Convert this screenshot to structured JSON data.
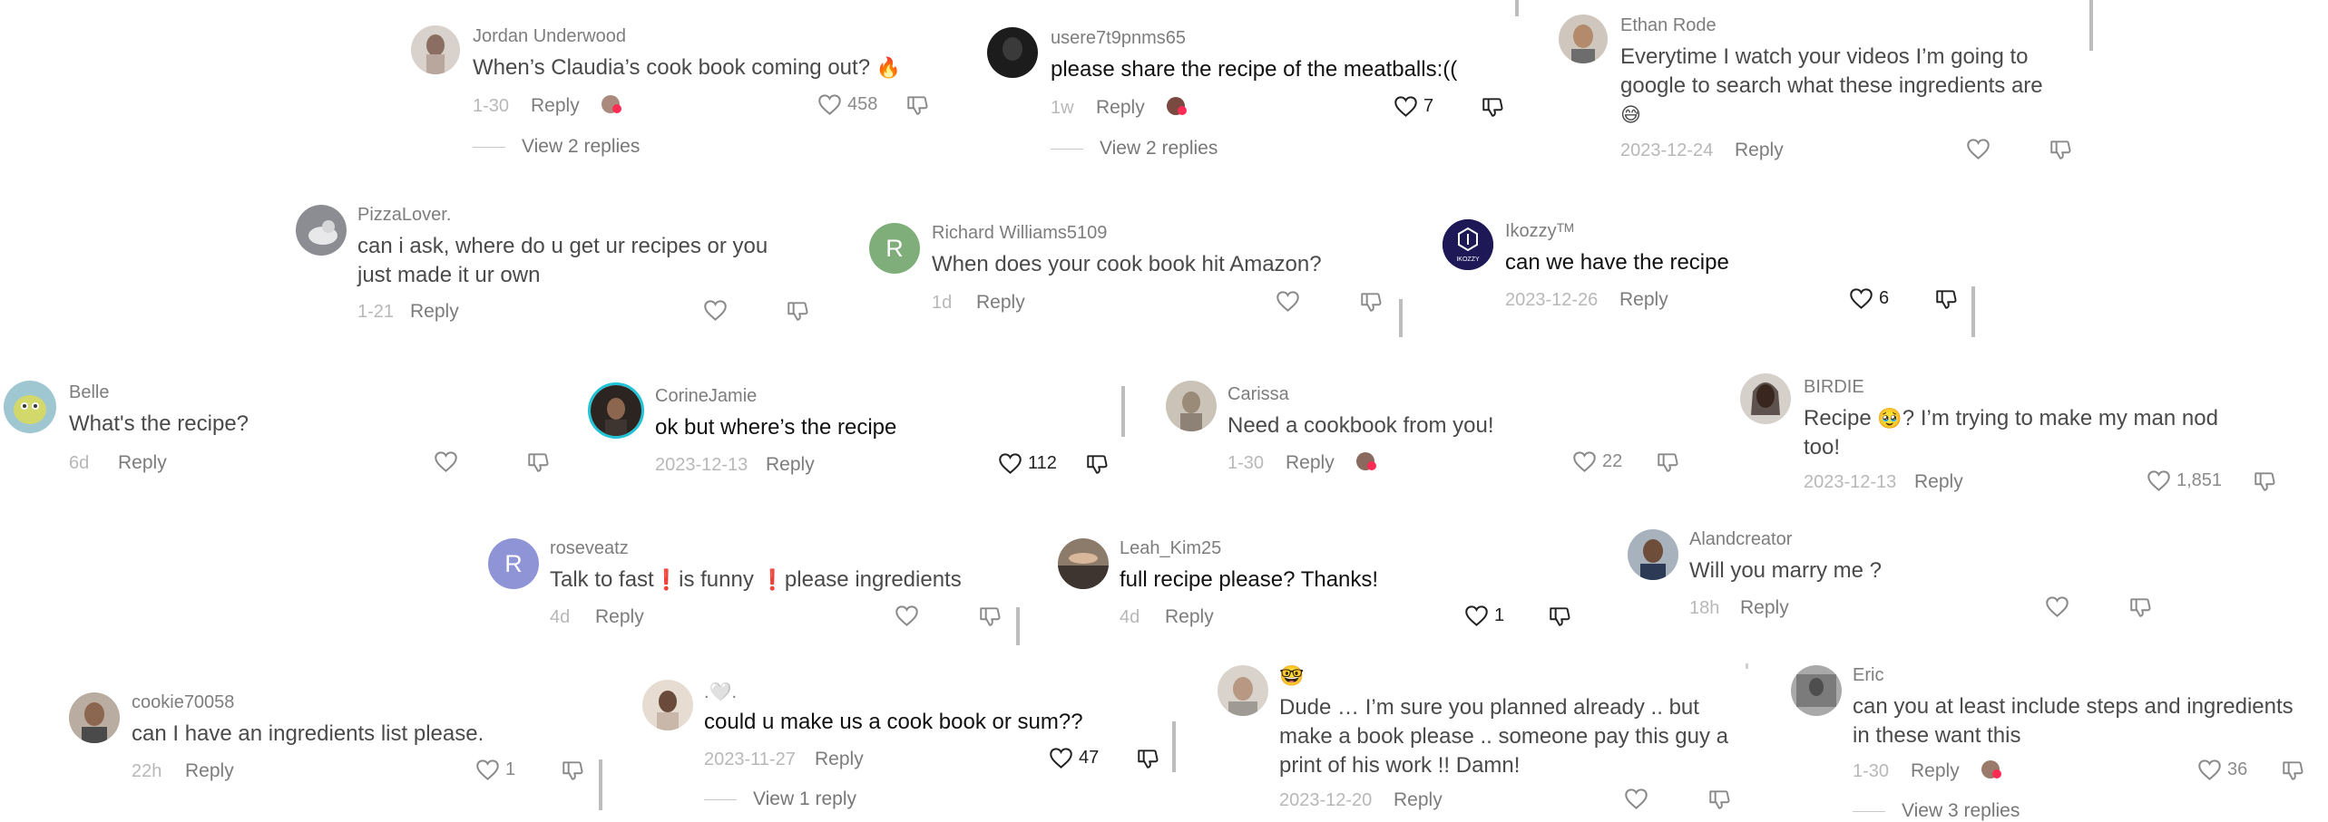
{
  "colors": {
    "username": "#7d7d7d",
    "text": "#4a4a4a",
    "meta": "#b8b8b8",
    "reply": "#7c7c7c",
    "avatar_rose": "#8f94d6",
    "avatar_richard": "#7fae7a",
    "creator_liked_heart": "#fe2c55"
  },
  "comments": [
    {
      "username": "Jordan Underwood",
      "text": "When’s Claudia’s cook book coming out?",
      "emoji": "🔥",
      "date": "1-30",
      "reply": "Reply",
      "likes": "458",
      "view_replies": "View 2 replies"
    },
    {
      "username": "usere7t9pnms65",
      "text": "please share the recipe of the meatballs:((",
      "date": "1w",
      "reply": "Reply",
      "likes": "7",
      "view_replies": "View 2 replies"
    },
    {
      "username": "Ethan Rode",
      "text_line1": "Everytime I watch your videos I’m going to",
      "text_line2": "google to search what these ingredients are",
      "emoji": "😅",
      "date": "2023-12-24",
      "reply": "Reply"
    },
    {
      "username": "PizzaLover.",
      "text_line1": "can i ask, where do u get ur recipes or you",
      "text_line2": "just made it ur own",
      "date": "1-21",
      "reply": "Reply"
    },
    {
      "username": "Richard Williams5109",
      "avatar_letter": "R",
      "text": "When does your cook book hit Amazon?",
      "date": "1d",
      "reply": "Reply"
    },
    {
      "username": "Ikozzyᵀᴹ",
      "avatar_text": "IKOZZY",
      "text": "can we have the recipe",
      "date": "2023-12-26",
      "reply": "Reply",
      "likes": "6"
    },
    {
      "username": "Belle",
      "text": "What's the recipe?",
      "date": "6d",
      "reply": "Reply"
    },
    {
      "username": "CorineJamie",
      "text": "ok but where’s the recipe",
      "date": "2023-12-13",
      "reply": "Reply",
      "likes": "112"
    },
    {
      "username": "Carissa",
      "text": "Need a cookbook from you!",
      "date": "1-30",
      "reply": "Reply",
      "likes": "22"
    },
    {
      "username": "BIRDIE",
      "text_line1_a": "Recipe",
      "emoji": "🥹",
      "text_line1_b": "? I’m trying to make my man nod",
      "text_line2": "too!",
      "date": "2023-12-13",
      "reply": "Reply",
      "likes": "1,851"
    },
    {
      "username": "roseveatz",
      "avatar_letter": "R",
      "text_a": "Talk to fast",
      "emoji": "❗",
      "text_b": "is funny",
      "text_c": "please ingredients",
      "date": "4d",
      "reply": "Reply"
    },
    {
      "username": "Leah_Kim25",
      "text": "full recipe please? Thanks!",
      "date": "4d",
      "reply": "Reply",
      "likes": "1"
    },
    {
      "username": "Alandcreator",
      "text": "Will you marry me ?",
      "date": "18h",
      "reply": "Reply"
    },
    {
      "username": "cookie70058",
      "text": "can I have an ingredients list please.",
      "date": "22h",
      "reply": "Reply",
      "likes": "1"
    },
    {
      "username": ".🤍.",
      "text": "could u make us a cook book or sum??",
      "date": "2023-11-27",
      "reply": "Reply",
      "likes": "47",
      "view_replies": "View 1 reply"
    },
    {
      "username": "🤓",
      "text_line1": "Dude … I’m sure you planned already .. but",
      "text_line2": "make a book please .. someone pay this guy a",
      "text_line3": "print of his work !! Damn!",
      "date": "2023-12-20",
      "reply": "Reply"
    },
    {
      "username": "Eric",
      "text_line1": "can you at least include steps and ingredients",
      "text_line2": "in these want this",
      "date": "1-30",
      "reply": "Reply",
      "likes": "36",
      "view_replies": "View 3 replies"
    }
  ]
}
